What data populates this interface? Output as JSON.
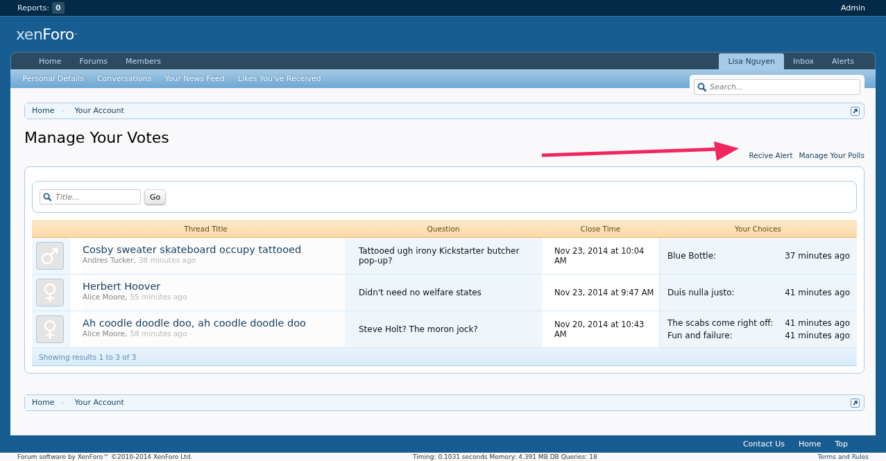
{
  "top_bar": {
    "reports_label": "Reports:",
    "reports_count": "0",
    "admin": "Admin"
  },
  "logo": {
    "left": "xen",
    "right": "Foro",
    "mark": "™"
  },
  "nav": {
    "tabs": [
      {
        "label": "Home",
        "selected": false
      },
      {
        "label": "Forums",
        "selected": false
      },
      {
        "label": "Members",
        "selected": false
      }
    ],
    "user_tabs": [
      {
        "label": "Lisa Nguyen",
        "selected": true
      },
      {
        "label": "Inbox",
        "selected": false
      },
      {
        "label": "Alerts",
        "selected": false
      }
    ],
    "sub_items": [
      "Personal Details",
      "Conversations",
      "Your News Feed",
      "Likes You've Received"
    ],
    "search": {
      "placeholder": "Search..."
    }
  },
  "breadcrumb": [
    "Home",
    "Your Account"
  ],
  "title": "Manage Your Votes",
  "links": [
    "Recive Alert",
    "Manage Your Polls"
  ],
  "filter": {
    "placeholder": "Title...",
    "button": "Go"
  },
  "table": {
    "columns": [
      "Thread Title",
      "Question",
      "Close Time",
      "Your Choices"
    ],
    "rows": [
      {
        "kind": "male",
        "title": "Cosby sweater skateboard occupy tattooed",
        "author": "Andres Tucker,",
        "time": "38 minutes ago",
        "question": "Tattooed ugh irony Kickstarter butcher pop-up?",
        "close_time": "Nov 23, 2014 at 10:04 AM",
        "choices": [
          {
            "option": "Blue Bottle:",
            "time": "37 minutes ago"
          }
        ]
      },
      {
        "kind": "female",
        "title": "Herbert Hoover",
        "author": "Alice Moore,",
        "time": "55 minutes ago",
        "question": "Didn't need no welfare states",
        "close_time": "Nov 23, 2014 at 9:47 AM",
        "choices": [
          {
            "option": "Duis nulla justo:",
            "time": "41 minutes ago"
          }
        ]
      },
      {
        "kind": "female",
        "title": "Ah coodle doodle doo, ah coodle doodle doo",
        "author": "Alice Moore,",
        "time": "58 minutes ago",
        "question": "Steve Holt? The moron jock?",
        "close_time": "Nov 20, 2014 at 10:43 AM",
        "choices": [
          {
            "option": "The scabs come right off:",
            "time": "41 minutes ago"
          },
          {
            "option": "Fun and failure:",
            "time": "41 minutes ago"
          }
        ]
      }
    ],
    "footer": "Showing results 1 to 3 of 3"
  },
  "breadcrumb_bottom": [
    "Home",
    "Your Account"
  ],
  "footer_links": [
    "Contact Us",
    "Home",
    "Top"
  ],
  "footer_bottom": {
    "copyright": "Forum software by XenForo™ ©2010-2014 XenForo Ltd.",
    "timing": "Timing: 0.1031 seconds Memory: 4.391 MB DB Queries: 18",
    "terms": "Terms and Rules"
  }
}
